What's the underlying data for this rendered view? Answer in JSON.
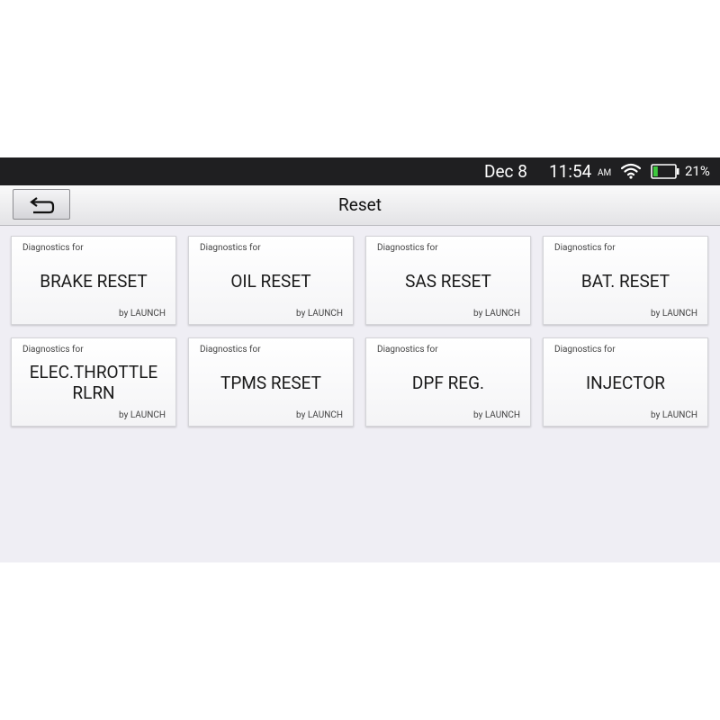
{
  "status_bar": {
    "date": "Dec 8",
    "time": "11:54",
    "ampm": "AM",
    "battery_percent": "21%",
    "battery_level": 0.21,
    "icons": [
      "wifi-icon",
      "battery-icon"
    ]
  },
  "title_bar": {
    "title": "Reset",
    "back_icon": "back-arrow-icon"
  },
  "tiles": [
    {
      "prefix": "Diagnostics for",
      "name": "BRAKE RESET",
      "vendor": "by LAUNCH"
    },
    {
      "prefix": "Diagnostics for",
      "name": "OIL RESET",
      "vendor": "by LAUNCH"
    },
    {
      "prefix": "Diagnostics for",
      "name": "SAS RESET",
      "vendor": "by LAUNCH"
    },
    {
      "prefix": "Diagnostics for",
      "name": "BAT. RESET",
      "vendor": "by LAUNCH"
    },
    {
      "prefix": "Diagnostics for",
      "name": "ELEC.THROTTLE RLRN",
      "vendor": "by LAUNCH"
    },
    {
      "prefix": "Diagnostics for",
      "name": "TPMS RESET",
      "vendor": "by LAUNCH"
    },
    {
      "prefix": "Diagnostics for",
      "name": "DPF REG.",
      "vendor": "by LAUNCH"
    },
    {
      "prefix": "Diagnostics for",
      "name": "INJECTOR",
      "vendor": "by LAUNCH"
    }
  ],
  "colors": {
    "status_bar_bg": "#1f1f21",
    "screen_bg": "#efeef4",
    "battery_fill": "#3ec83e"
  }
}
